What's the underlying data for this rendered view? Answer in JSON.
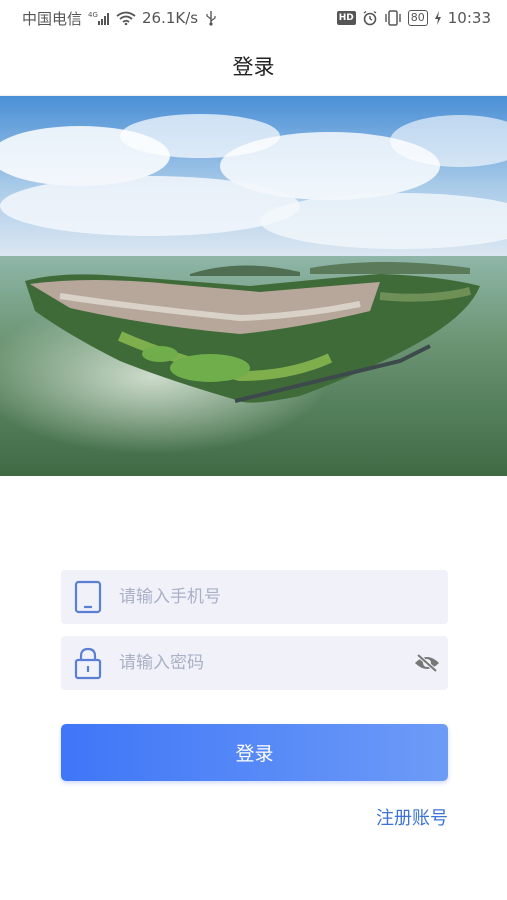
{
  "status_bar": {
    "carrier": "中国电信",
    "network_speed": "26.1K/s",
    "battery": "80",
    "time": "10:33",
    "hd_badge": "HD"
  },
  "header": {
    "title": "登录"
  },
  "hero": {
    "alt": "湖中半岛航拍"
  },
  "form": {
    "phone_placeholder": "请输入手机号",
    "password_placeholder": "请输入密码",
    "login_label": "登录",
    "register_label": "注册账号"
  },
  "colors": {
    "accent": "#3f76f7",
    "accent_light": "#6d9bf7",
    "field_bg": "#f0f1f9",
    "link": "#3d73d6",
    "icon": "#5b7fd4"
  },
  "icons": [
    "signal-icon",
    "wifi-icon",
    "usb-icon",
    "hd-icon",
    "alarm-icon",
    "vibrate-icon",
    "battery-icon",
    "charging-icon",
    "tablet-icon",
    "lock-icon",
    "eye-off-icon"
  ]
}
